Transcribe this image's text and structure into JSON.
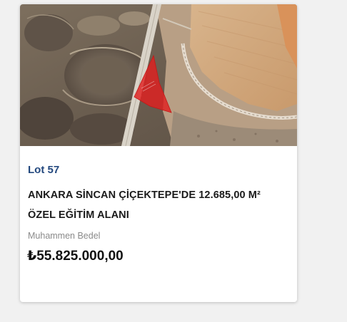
{
  "card": {
    "image_alt": "Aerial satellite view of land parcel highlighted in red",
    "lot_label": "Lot 57",
    "title_line1": "ANKARA SİNCAN ÇİÇEKTEPE'DE 12.685,00 M²",
    "title_line2": "ÖZEL EĞİTİM ALANI",
    "estimate_label": "Muhammen Bedel",
    "price": "₺55.825.000,00"
  },
  "colors": {
    "lot_label": "#23487e",
    "parcel_highlight": "#e02020"
  }
}
